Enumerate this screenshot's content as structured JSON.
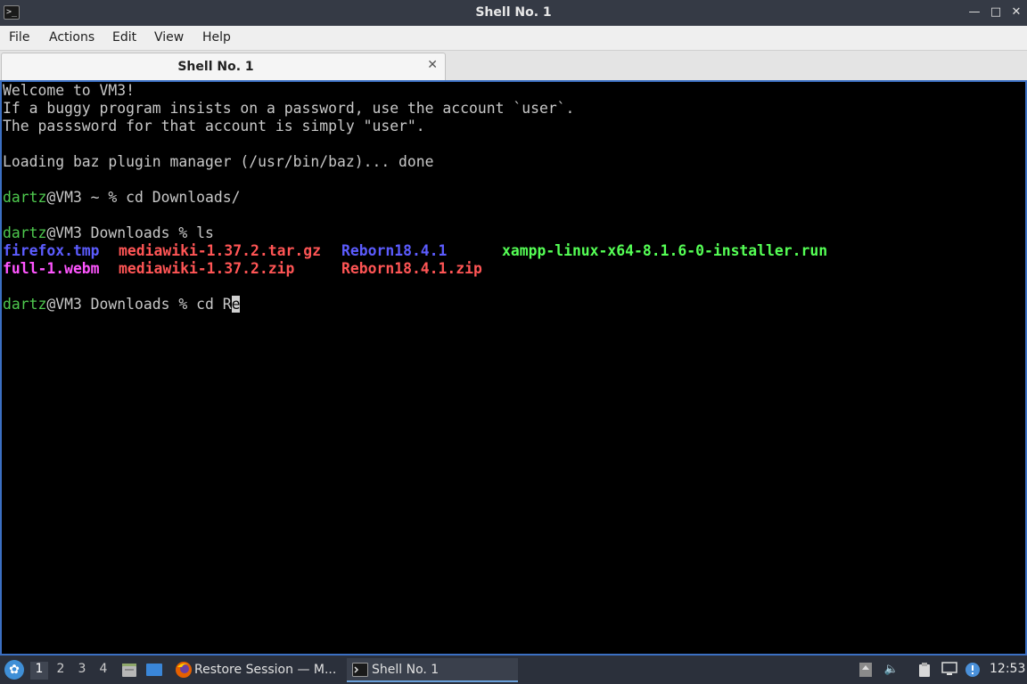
{
  "window": {
    "title": "Shell No. 1",
    "controls": [
      "minimize-icon",
      "maximize-icon",
      "close-icon"
    ]
  },
  "menubar": {
    "items": [
      "File",
      "Actions",
      "Edit",
      "View",
      "Help"
    ]
  },
  "tabs": [
    {
      "label": "Shell No. 1",
      "active": true
    }
  ],
  "terminal": {
    "welcome": "Welcome to VM3!",
    "notice1": "If a buggy program insists on a password, use the account `user`.",
    "notice2": "The passsword for that account is simply \"user\".",
    "loading": "Loading baz plugin manager (/usr/bin/baz)... done",
    "prompt1": {
      "user": "dartz",
      "host_path": "@VM3 ~ % ",
      "command": "cd Downloads/"
    },
    "prompt2": {
      "user": "dartz",
      "host_path": "@VM3 Downloads % ",
      "command": "ls"
    },
    "ls_row1": [
      "firefox.tmp",
      "mediawiki-1.37.2.tar.gz",
      "Reborn18.4.1",
      "xampp-linux-x64-8.1.6-0-installer.run"
    ],
    "ls_row2": [
      "full-1.webm",
      "mediawiki-1.37.2.zip",
      "Reborn18.4.1.zip"
    ],
    "prompt3": {
      "user": "dartz",
      "host_path": "@VM3 Downloads % ",
      "command": "cd R",
      "cursor_char": "e"
    },
    "colors": {
      "background": "#000000",
      "text": "#c8c8c8",
      "prompt_user": "#4ec94e",
      "directory": "#5c5cff",
      "archive": "#ff5555",
      "executable": "#55ff55",
      "media": "#ff55ff"
    }
  },
  "taskbar": {
    "workspaces": [
      "1",
      "2",
      "3",
      "4"
    ],
    "active_workspace": "1",
    "tasks": [
      {
        "label": "Restore Session — M...",
        "icon": "firefox-icon",
        "active": false
      },
      {
        "label": "Shell No. 1",
        "icon": "terminal-icon",
        "active": true
      }
    ],
    "tray_icons": [
      "updates-icon",
      "volume-icon",
      "clipboard-icon",
      "network-icon",
      "notification-icon"
    ],
    "clock": "12:53"
  }
}
